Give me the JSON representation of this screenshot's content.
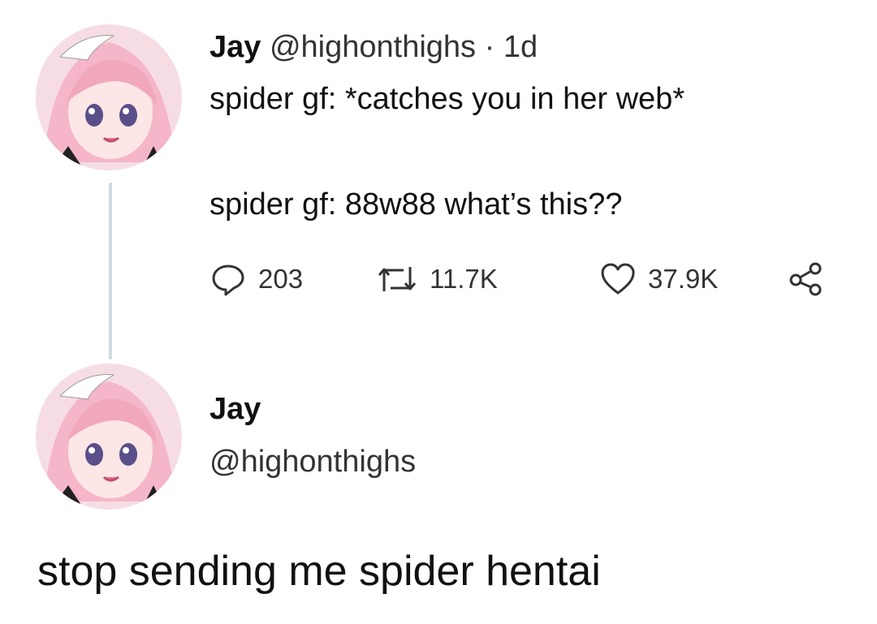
{
  "tweet": {
    "author_name": "Jay",
    "author_handle": "@highonthighs",
    "separator": "·",
    "time": "1d",
    "text_line_1": "spider gf: *catches you in her web*",
    "text_line_2": "spider gf: 88w88 what’s this??",
    "actions": {
      "reply_icon": "reply-bubble-icon",
      "reply_count": "203",
      "retweet_icon": "retweet-icon",
      "retweet_count": "11.7K",
      "like_icon": "heart-icon",
      "like_count": "37.9K",
      "share_icon": "share-icon"
    }
  },
  "reply": {
    "author_name": "Jay",
    "author_handle": "@highonthighs",
    "text": "stop sending me spider hentai"
  },
  "colors": {
    "background": "#ffffff",
    "text_primary": "#111111",
    "text_secondary": "#333333",
    "thread_line": "#cfd9de",
    "avatar_hair": "#f4b6c8",
    "avatar_skin": "#fde6e6"
  }
}
